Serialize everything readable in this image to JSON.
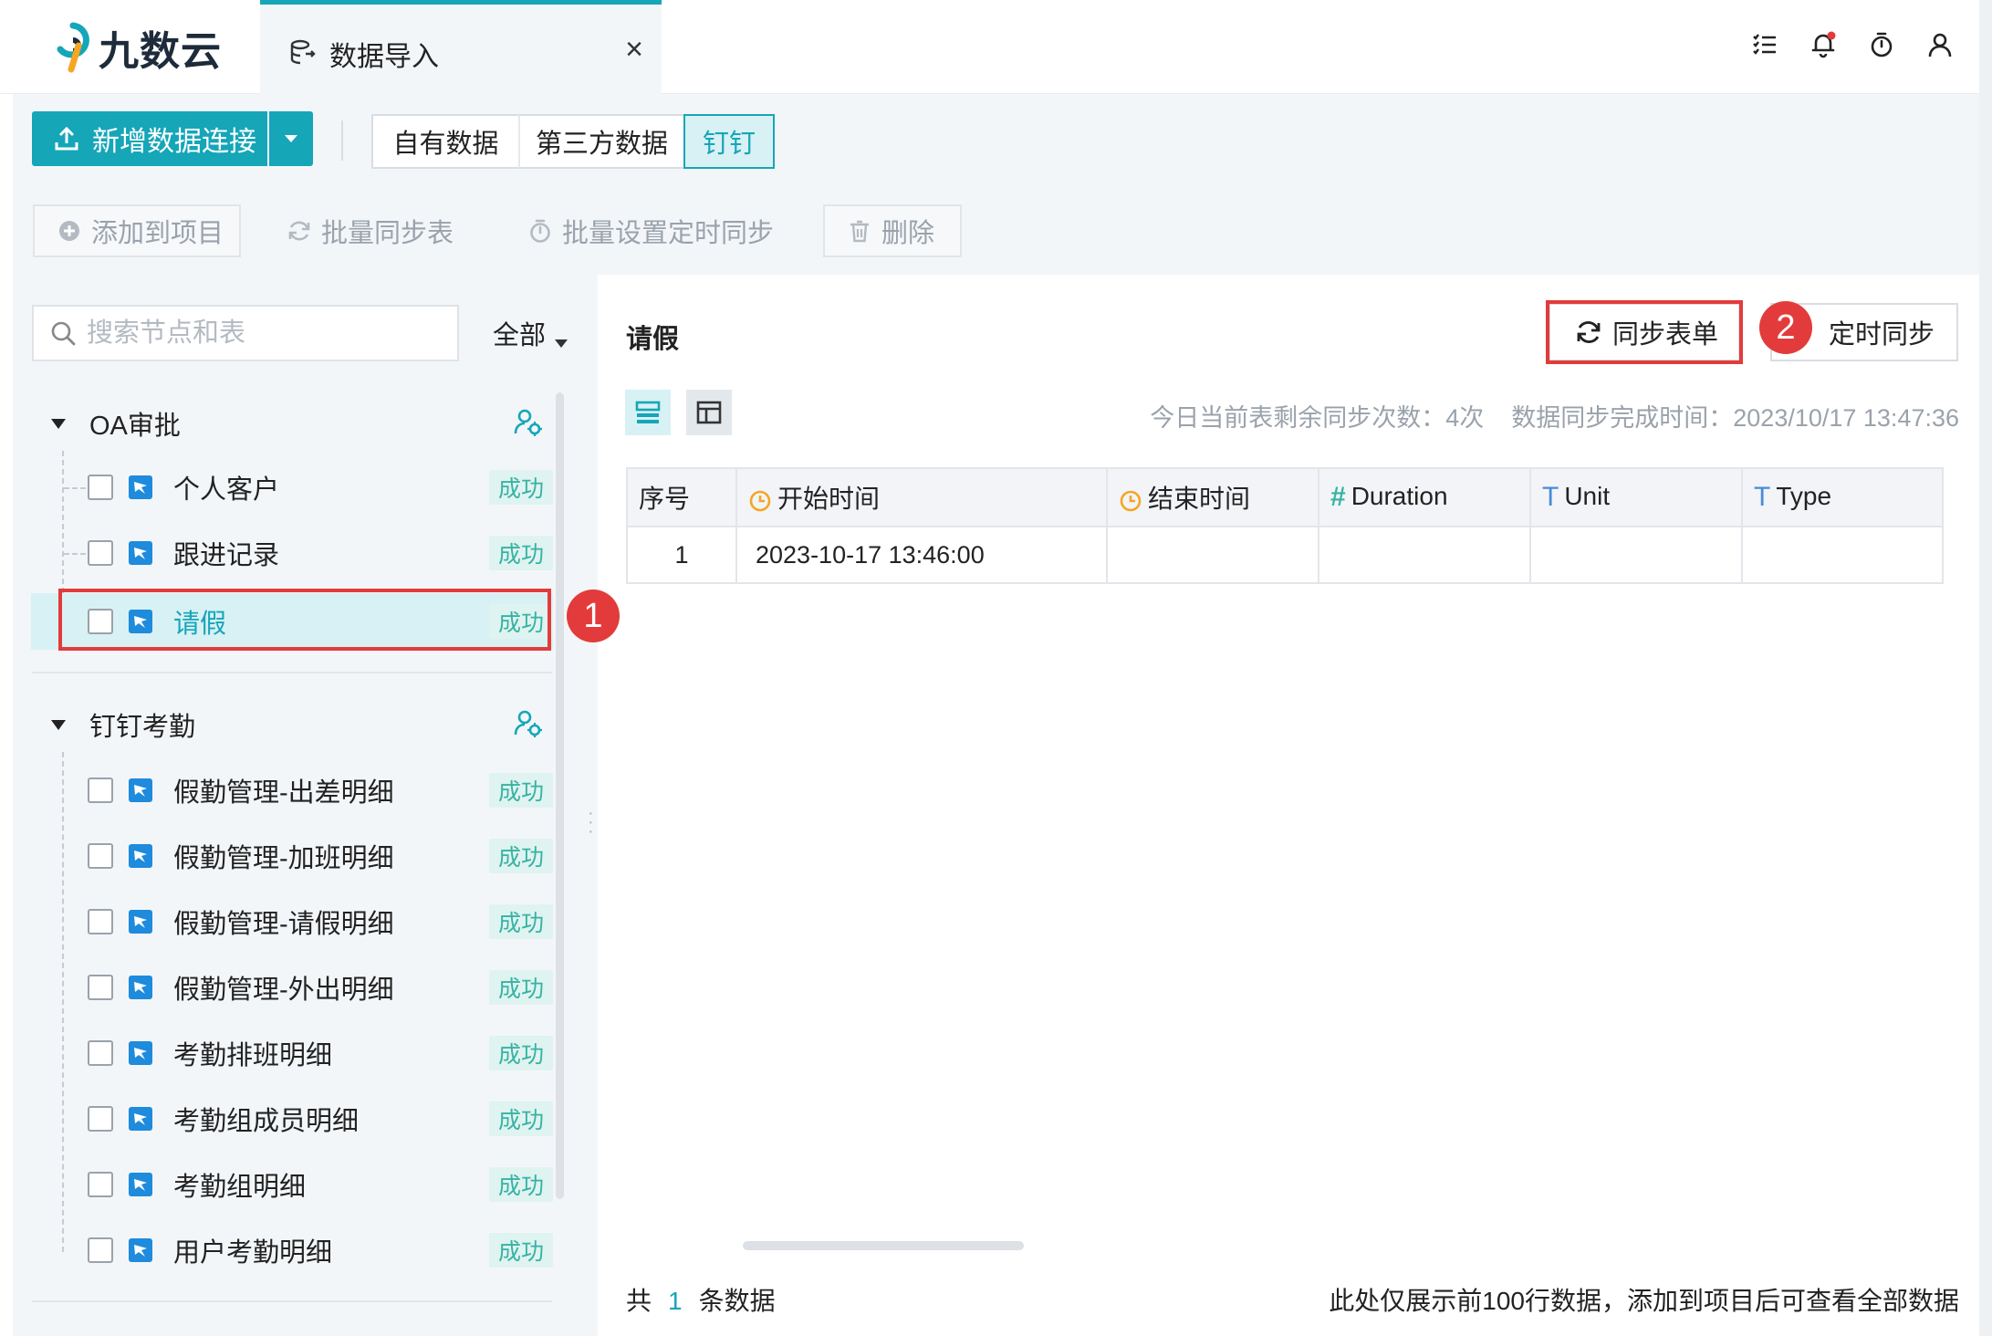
{
  "app": {
    "logo_text": "九数云"
  },
  "tab": {
    "label": "数据导入",
    "close": "×"
  },
  "topbar": {
    "icons": [
      "list-icon",
      "bell-icon",
      "timer-icon",
      "user-icon"
    ],
    "notification_dot_color": "#e33b3b"
  },
  "toolbar": {
    "new_connection": "新增数据连接",
    "segments": [
      "自有数据",
      "第三方数据",
      "钉钉"
    ],
    "active_segment": "钉钉",
    "add_to_project": "添加到项目",
    "batch_sync": "批量同步表",
    "batch_timer": "批量设置定时同步",
    "delete": "删除"
  },
  "left": {
    "search_placeholder": "搜索节点和表",
    "filter": "全部",
    "groups": [
      {
        "name": "OA审批",
        "items": [
          {
            "name": "个人客户",
            "status": "成功"
          },
          {
            "name": "跟进记录",
            "status": "成功"
          },
          {
            "name": "请假",
            "status": "成功",
            "selected": true
          }
        ]
      },
      {
        "name": "钉钉考勤",
        "items": [
          {
            "name": "假勤管理-出差明细",
            "status": "成功"
          },
          {
            "name": "假勤管理-加班明细",
            "status": "成功"
          },
          {
            "name": "假勤管理-请假明细",
            "status": "成功"
          },
          {
            "name": "假勤管理-外出明细",
            "status": "成功"
          },
          {
            "name": "考勤排班明细",
            "status": "成功"
          },
          {
            "name": "考勤组成员明细",
            "status": "成功"
          },
          {
            "name": "考勤组明细",
            "status": "成功"
          },
          {
            "name": "用户考勤明细",
            "status": "成功"
          }
        ]
      }
    ]
  },
  "main": {
    "title": "请假",
    "sync_form": "同步表单",
    "timer_sync": "定时同步",
    "remaining_sync": "今日当前表剩余同步次数：4次",
    "sync_time": "数据同步完成时间：2023/10/17 13:47:36",
    "columns": [
      "序号",
      "开始时间",
      "结束时间",
      "Duration",
      "Unit",
      "Type"
    ],
    "rows": [
      [
        "1",
        "2023-10-17 13:46:00",
        "",
        "",
        "",
        ""
      ]
    ],
    "footer_prefix": "共",
    "footer_count": "1",
    "footer_suffix": "条数据",
    "footer_note": "此处仅展示前100行数据，添加到项目后可查看全部数据"
  },
  "annotations": {
    "marker_1": "1",
    "marker_2": "2"
  },
  "colors": {
    "accent": "#15a6b8",
    "success_bg": "#dff3f0",
    "success_text": "#37b3a3",
    "annotation": "#e33b3b"
  }
}
